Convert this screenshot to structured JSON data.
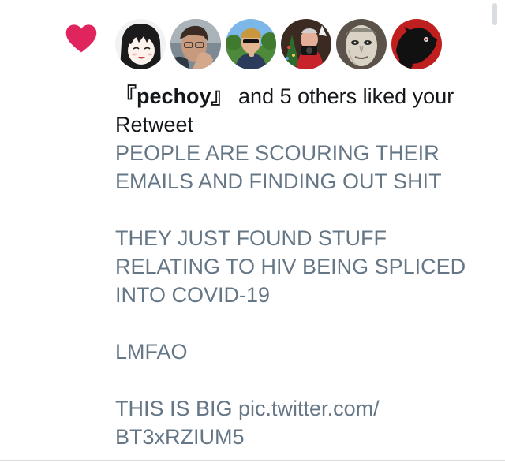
{
  "notification": {
    "type_icon": "heart-icon",
    "heart_color": "#e0245e",
    "avatars": [
      {
        "name": "anime-girl-avatar"
      },
      {
        "name": "man-glasses-avatar"
      },
      {
        "name": "man-sunglasses-avatar"
      },
      {
        "name": "holiday-man-avatar"
      },
      {
        "name": "pale-face-avatar"
      },
      {
        "name": "red-black-animal-avatar"
      }
    ],
    "summary": {
      "actor": "『pechoy』",
      "rest_line1": " and 5 others liked your",
      "rest_line2": "Retweet"
    },
    "tweet": {
      "line1": "PEOPLE ARE SCOURING THEIR",
      "line2": "EMAILS AND FINDING OUT SHIT",
      "line3": "THEY JUST FOUND STUFF",
      "line4": "RELATING TO HIV BEING SPLICED",
      "line5": "INTO COVID-19",
      "line6": "LMFAO",
      "line7": "THIS IS BIG pic.twitter.com/",
      "line8": "BT3xRZIUM5"
    }
  },
  "colors": {
    "text_primary": "#14171a",
    "text_secondary": "#657786",
    "divider": "#d8dde2"
  }
}
